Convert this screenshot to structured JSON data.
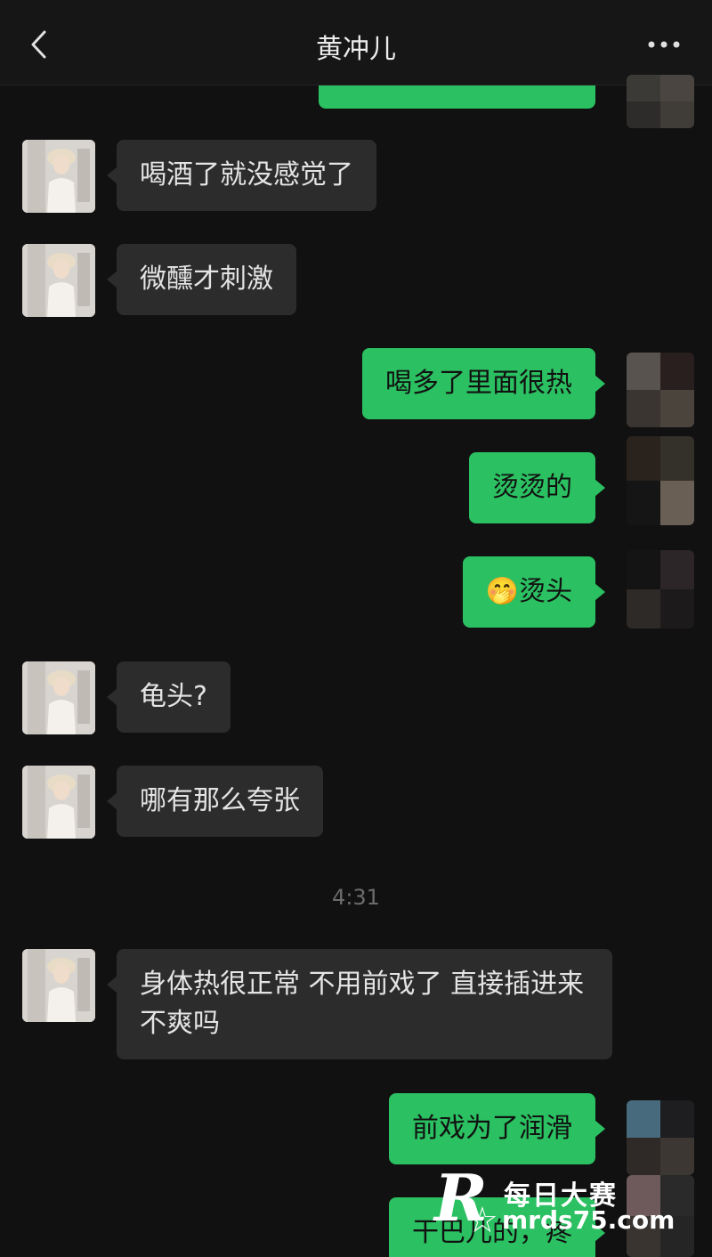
{
  "header": {
    "title": "黄冲儿",
    "back_icon": "chevron-left-icon",
    "more_icon": "more-dots-icon"
  },
  "messages": [
    {
      "side": "in",
      "text": "喝酒了就没感觉了"
    },
    {
      "side": "in",
      "text": "微醺才刺激"
    },
    {
      "side": "out",
      "text": "喝多了里面很热"
    },
    {
      "side": "out",
      "text": "烫烫的"
    },
    {
      "side": "out",
      "emoji": "🤭",
      "text": "烫头"
    },
    {
      "side": "in",
      "text": "龟头?"
    },
    {
      "side": "in",
      "text": "哪有那么夸张"
    },
    {
      "side": "in",
      "text": "身体热很正常 不用前戏了 直接插进来不爽吗"
    },
    {
      "side": "out",
      "text": "前戏为了润滑"
    },
    {
      "side": "out",
      "text": "干巴儿的，疼"
    }
  ],
  "timestamp": "4:31",
  "watermark": {
    "letter": "R",
    "name": "每日大赛",
    "url": "mrds75.com"
  },
  "colors": {
    "background": "#111111",
    "incoming_bubble": "#2c2c2c",
    "outgoing_bubble": "#2bc061"
  }
}
